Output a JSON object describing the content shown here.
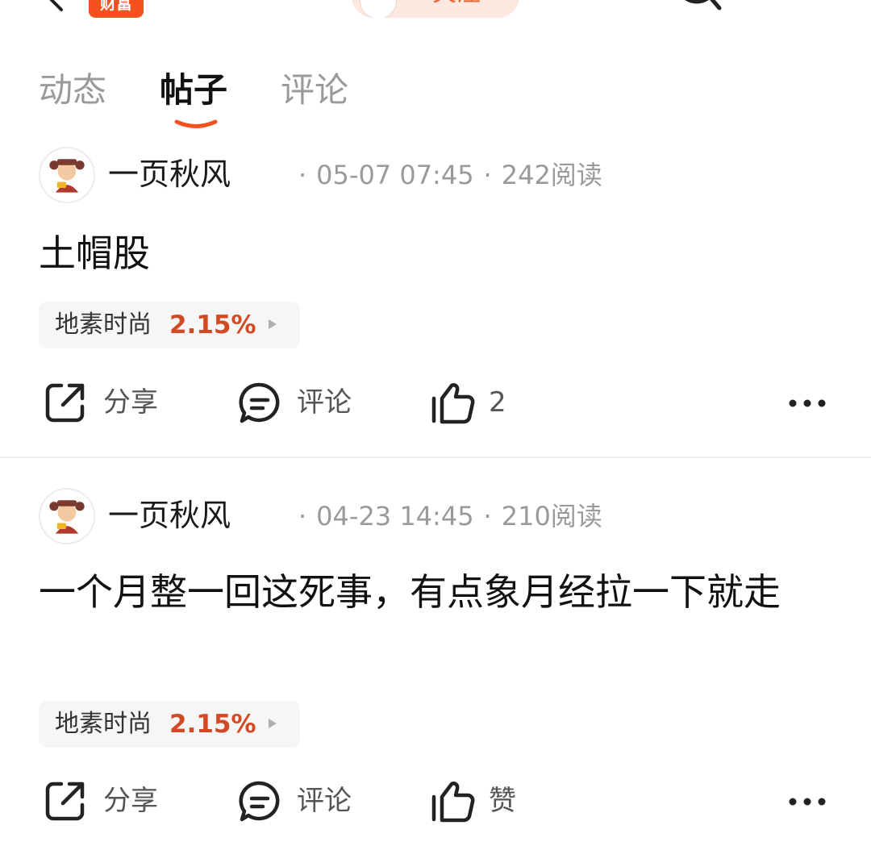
{
  "header": {
    "brand_badge": "财富",
    "follow_label": "关注"
  },
  "tabs": [
    {
      "label": "动态"
    },
    {
      "label": "帖子"
    },
    {
      "label": "评论"
    }
  ],
  "posts": [
    {
      "author": "一页秋风",
      "date": "05-07 07:45",
      "reads": "242阅读",
      "text": "土帽股",
      "stock": {
        "name": "地素时尚",
        "change": "2.15%"
      },
      "actions": {
        "share": "分享",
        "comment": "评论",
        "like": "2"
      }
    },
    {
      "author": "一页秋风",
      "date": "04-23 14:45",
      "reads": "210阅读",
      "text": "一个月整一回这死事，有点象月经拉一下就走",
      "stock": {
        "name": "地素时尚",
        "change": "2.15%"
      },
      "actions": {
        "share": "分享",
        "comment": "评论",
        "like": "赞"
      }
    }
  ],
  "separator": "·",
  "colors": {
    "accent": "#f4511e",
    "stock_up": "#d24a24",
    "muted": "#9a9a9a"
  }
}
